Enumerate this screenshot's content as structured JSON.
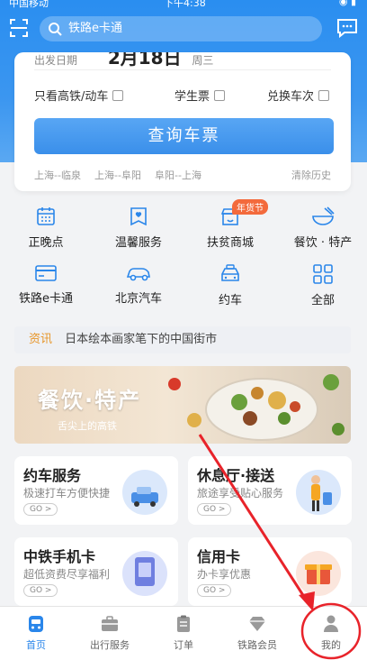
{
  "status_bar": {
    "carrier": "中国移动",
    "time": "下午4:38"
  },
  "header": {
    "search_text": "铁路e卡通"
  },
  "ticket": {
    "date_label": "出发日期",
    "date_value": "2月18日",
    "weekday": "周三",
    "opt_gaotie": "只看高铁/动车",
    "opt_student": "学生票",
    "opt_exchange": "兑换车次",
    "query_button": "查询车票",
    "history": [
      "上海--临泉",
      "上海--阜阳",
      "阜阳--上海"
    ],
    "clear_history": "清除历史"
  },
  "services": [
    {
      "label": "正晚点",
      "icon": "calendar-icon"
    },
    {
      "label": "温馨服务",
      "icon": "heart-bag-icon"
    },
    {
      "label": "扶贫商城",
      "icon": "shop-icon"
    },
    {
      "label": "餐饮 · 特产",
      "icon": "bowl-icon"
    },
    {
      "label": "铁路e卡通",
      "icon": "card-icon"
    },
    {
      "label": "北京汽车",
      "icon": "car-icon"
    },
    {
      "label": "约车",
      "icon": "taxi-icon"
    },
    {
      "label": "全部",
      "icon": "grid-icon"
    }
  ],
  "festival_badge": "年货节",
  "news": {
    "tag": "资讯",
    "text": "日本绘本画家笔下的中国街市"
  },
  "banner": {
    "title": "餐饮·特产",
    "subtitle": "舌尖上的高铁"
  },
  "cards": [
    {
      "title": "约车服务",
      "desc": "极速打车方便快捷",
      "go": "GO >"
    },
    {
      "title": "休息厅·接送",
      "desc": "旅途享受贴心服务",
      "go": "GO >"
    },
    {
      "title": "中铁手机卡",
      "desc": "超低资费尽享福利",
      "go": "GO >"
    },
    {
      "title": "信用卡",
      "desc": "办卡享优惠",
      "go": "GO >"
    }
  ],
  "tabs": [
    {
      "label": "首页",
      "icon": "home-icon",
      "active": true
    },
    {
      "label": "出行服务",
      "icon": "briefcase-icon",
      "active": false
    },
    {
      "label": "订单",
      "icon": "order-icon",
      "active": false
    },
    {
      "label": "铁路会员",
      "icon": "diamond-icon",
      "active": false
    },
    {
      "label": "我的",
      "icon": "person-icon",
      "active": false
    }
  ],
  "colors": {
    "primary": "#2a86ea",
    "annotation": "#e8232a",
    "badge": "#f36a3c"
  }
}
